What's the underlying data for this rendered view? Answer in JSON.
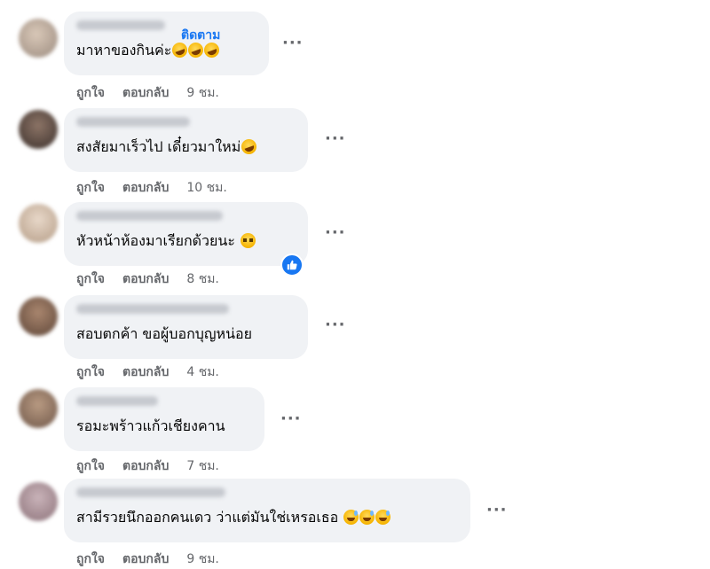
{
  "comments": [
    {
      "follow": "ติดตาม",
      "text": "มาหาของกินค่ะ",
      "emoji_icons": [
        "laugh-cry-icon",
        "laugh-cry-icon",
        "laugh-cry-icon"
      ],
      "like": "ถูกใจ",
      "reply": "ตอบกลับ",
      "time": "9 ชม."
    },
    {
      "text": "สงสัยมาเร็วไป เดี๋ยวมาใหม่",
      "emoji_icons": [
        "laugh-cry-icon"
      ],
      "like": "ถูกใจ",
      "reply": "ตอบกลับ",
      "time": "10 ชม."
    },
    {
      "text": "หัวหน้าห้องมาเรียกด้วยนะ",
      "emoji_icons": [
        "pleading-face-icon"
      ],
      "reaction_icon": "thumbs-up-icon",
      "like": "ถูกใจ",
      "reply": "ตอบกลับ",
      "time": "8 ชม."
    },
    {
      "text": "สอบตกค้า ขอผู้บอกบุญหน่อย",
      "like": "ถูกใจ",
      "reply": "ตอบกลับ",
      "time": "4 ชม."
    },
    {
      "text": "รอมะพร้าวแก้วเชียงคาน",
      "like": "ถูกใจ",
      "reply": "ตอบกลับ",
      "time": "7 ชม."
    },
    {
      "text": "สามีรวยนึกออกคนเดว ว่าแต่มันใช่เหรอเธอ",
      "emoji_icons": [
        "grinning-sweat-icon",
        "grinning-sweat-icon",
        "grinning-sweat-icon"
      ],
      "like": "ถูกใจ",
      "reply": "ตอบกลับ",
      "time": "9 ชม."
    }
  ],
  "more_label": "···",
  "colors": {
    "bubble": "#f0f2f5",
    "link": "#1877f2",
    "muted": "#65676b"
  }
}
